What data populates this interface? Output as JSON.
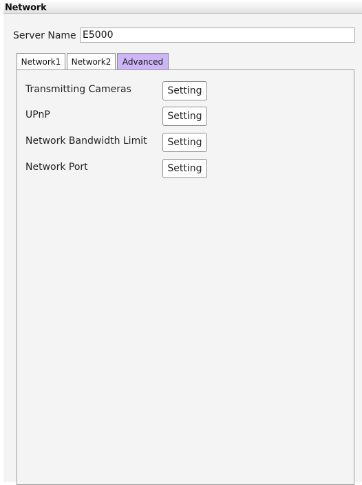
{
  "window": {
    "title": "Network"
  },
  "server": {
    "label": "Server Name",
    "value": "E5000"
  },
  "tabs": [
    {
      "label": "Network1",
      "active": false
    },
    {
      "label": "Network2",
      "active": false
    },
    {
      "label": "Advanced",
      "active": true
    }
  ],
  "colors": {
    "active_tab": "#cdb6f5",
    "panel_bg": "#f4f4f4"
  },
  "advanced": {
    "rows": [
      {
        "label": "Transmitting Cameras",
        "button": "Setting"
      },
      {
        "label": "UPnP",
        "button": "Setting"
      },
      {
        "label": "Network Bandwidth Limit",
        "button": "Setting"
      },
      {
        "label": "Network Port",
        "button": "Setting"
      }
    ]
  }
}
